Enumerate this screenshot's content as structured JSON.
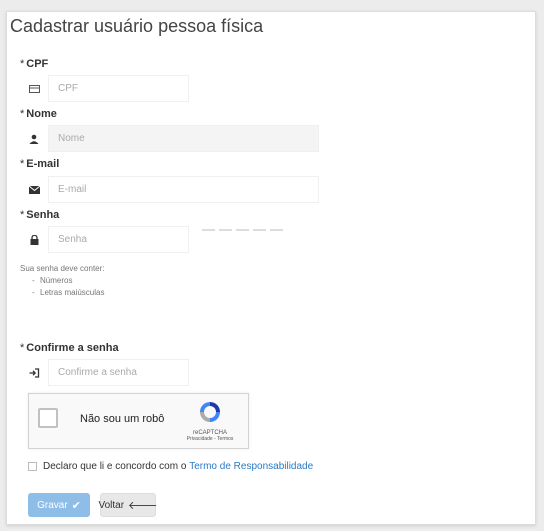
{
  "title": "Cadastrar usuário pessoa física",
  "required_marker": "*",
  "fields": {
    "cpf": {
      "label": "CPF",
      "placeholder": "CPF",
      "icon": "id-card-icon"
    },
    "nome": {
      "label": "Nome",
      "placeholder": "Nome",
      "icon": "user-icon"
    },
    "email": {
      "label": "E-mail",
      "placeholder": "E-mail",
      "icon": "envelope-icon"
    },
    "senha": {
      "label": "Senha",
      "placeholder": "Senha",
      "icon": "lock-icon"
    },
    "confirm": {
      "label": "Confirme a senha",
      "placeholder": "Confirme a senha",
      "icon": "sign-in-icon"
    }
  },
  "password_hint": {
    "intro": "Sua senha deve conter:",
    "items": [
      "Números",
      "Letras maiúsculas"
    ]
  },
  "captcha": {
    "label": "Não sou um robô",
    "brand": "reCAPTCHA",
    "links": "Privacidade - Termos"
  },
  "declaration": {
    "text": "Declaro que li e concordo com o",
    "link": "Termo de Responsabilidade"
  },
  "buttons": {
    "save": "Gravar",
    "back": "Voltar"
  }
}
